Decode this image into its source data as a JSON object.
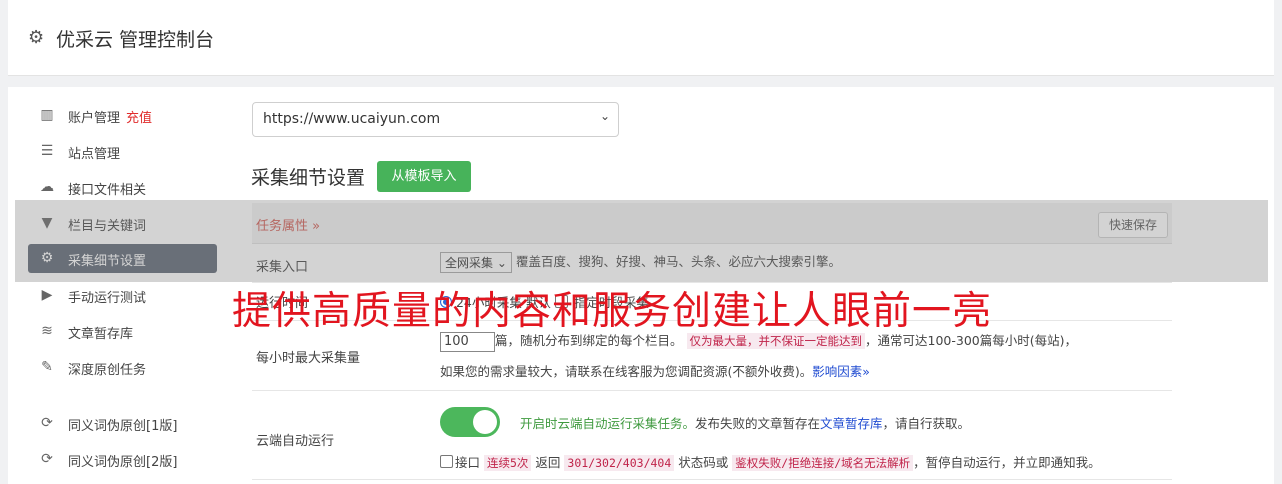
{
  "header": {
    "title": "优采云 管理控制台",
    "icon": "gear-icon"
  },
  "sidebar": {
    "items": [
      {
        "label": "账户管理",
        "extra": "充值",
        "icon": "bar-chart-icon"
      },
      {
        "label": "站点管理",
        "icon": "server-icon"
      },
      {
        "label": "接口文件相关",
        "icon": "cloud-upload-icon"
      },
      {
        "label": "栏目与关键词",
        "icon": "filter-icon"
      },
      {
        "label": "采集细节设置",
        "icon": "gears-icon",
        "active": true
      },
      {
        "label": "手动运行测试",
        "icon": "play-circle-icon"
      },
      {
        "label": "文章暂存库",
        "icon": "database-icon"
      },
      {
        "label": "深度原创任务",
        "icon": "edit-icon"
      },
      {
        "label": "同义词伪原创[1版]",
        "icon": "refresh-icon"
      },
      {
        "label": "同义词伪原创[2版]",
        "icon": "refresh-icon"
      }
    ]
  },
  "main": {
    "site_select": "https://www.ucaiyun.com",
    "section_title": "采集细节设置",
    "import_button": "从模板导入",
    "task_props": "任务属性 »",
    "quick_save": "快速保存",
    "entry": {
      "label": "采集入口",
      "select": "全网采集",
      "desc": "覆盖百度、搜狗、好搜、神马、头条、必应六大搜索引擎。"
    },
    "run_time": {
      "label": "运行时间",
      "option1": "24小时采集",
      "option2": "默认",
      "option3": "指定时段采集"
    },
    "max_per_hour": {
      "label": "每小时最大采集量",
      "value": "100",
      "text1": "篇，随机分布到绑定的每个栏目。",
      "highlight": "仅为最大量，并不保证一定能达到",
      "text2": "，通常可达100-300篇每小时(每站)，",
      "text3": "如果您的需求量较大，请联系在线客服为您调配资源(不额外收费)。",
      "link": "影响因素»"
    },
    "cloud_run": {
      "label": "云端自动运行",
      "green": "开启时云端自动运行采集任务。",
      "text1": "发布失败的文章暂存在",
      "link": "文章暂存库",
      "text2": "，请自行获取。",
      "api": "接口",
      "c1": "连续5次",
      "t2": "返回",
      "c2": "301/302/403/404",
      "t3": "状态码或",
      "c3": "鉴权失败/拒绝连接/域名无法解析",
      "t4": "，暂停自动运行，并立即通知我。"
    }
  },
  "overlay": {
    "text": "提供高质量的内容和服务创建让人眼前一亮"
  },
  "colors": {
    "accent_green": "#47b35a",
    "active_sidebar": "#5d6673",
    "overlay_red": "#e2151f"
  }
}
